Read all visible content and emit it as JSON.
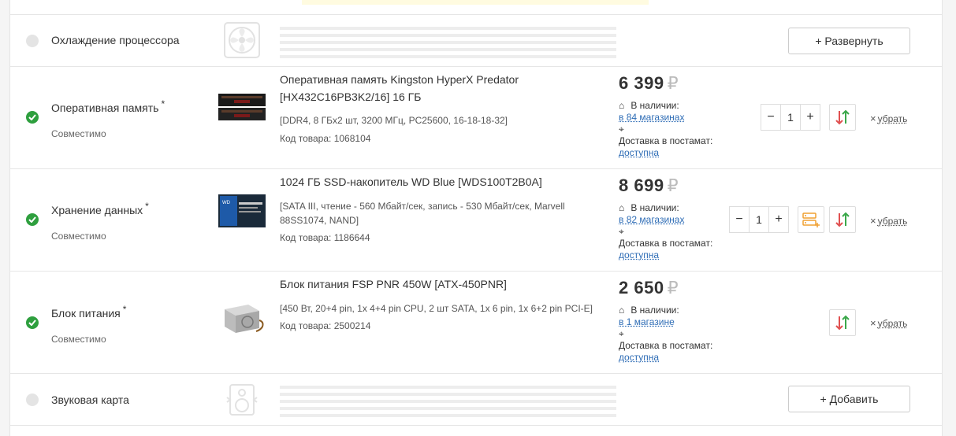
{
  "rows": [
    {
      "category": "Охлаждение процессора",
      "button_label": "+ Развернуть",
      "icon": "fan-icon"
    },
    {
      "category": "Оперативная память",
      "required_mark": "*",
      "compat": "Совместимо",
      "name": "Оперативная память Kingston HyperX Predator [HX432C16PB3K2/16] 16 ГБ",
      "specs": "[DDR4, 8 ГБx2 шт, 3200 МГц, PC25600, 16-18-18-32]",
      "code": "Код товара: 1068104",
      "price": "6 399",
      "currency": "₽",
      "avail_label": "В наличии:",
      "avail_link": "в 84 магазинах",
      "delivery_label": "Доставка в постамат:",
      "delivery_link": "доступна",
      "qty": "1",
      "qty_minus": "−",
      "qty_plus": "+",
      "remove_label": "убрать",
      "remove_x": "×"
    },
    {
      "category": "Хранение данных",
      "required_mark": "*",
      "compat": "Совместимо",
      "name": "1024 ГБ SSD-накопитель WD Blue [WDS100T2B0A]",
      "specs": "[SATA III, чтение - 560 Мбайт/сек, запись - 530 Мбайт/сек, Marvell 88SS1074, NAND]",
      "code": "Код товара: 1186644",
      "price": "8 699",
      "currency": "₽",
      "avail_label": "В наличии:",
      "avail_link": "в 82 магазинах",
      "delivery_label": "Доставка в постамат:",
      "delivery_link": "доступна",
      "qty": "1",
      "qty_minus": "−",
      "qty_plus": "+",
      "remove_label": "убрать",
      "remove_x": "×"
    },
    {
      "category": "Блок питания",
      "required_mark": "*",
      "compat": "Совместимо",
      "name": "Блок питания FSP PNR 450W [ATX-450PNR]",
      "specs": "[450 Вт, 20+4 pin, 1x 4+4 pin CPU, 2 шт SATA, 1x 6 pin, 1x 6+2 pin PCI-E]",
      "code": "Код товара: 2500214",
      "price": "2 650",
      "currency": "₽",
      "avail_label": "В наличии:",
      "avail_link": "в 1 магазине",
      "delivery_label": "Доставка в постамат:",
      "delivery_link": "доступна",
      "remove_label": "убрать",
      "remove_x": "×"
    },
    {
      "category": "Звуковая карта",
      "button_label": "+ Добавить",
      "icon": "speaker-icon"
    }
  ],
  "colors": {
    "ok_green": "#2e9f3e",
    "link_blue": "#2f6db6",
    "swap_red": "#e05050",
    "swap_green": "#3aa84a",
    "compare_orange": "#f0a030"
  }
}
